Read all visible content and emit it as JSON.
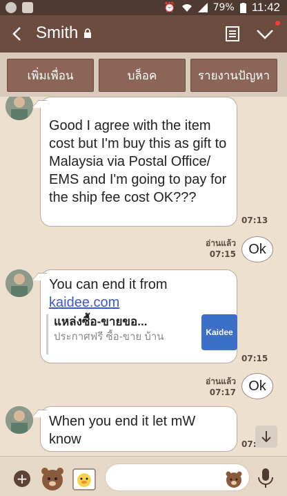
{
  "status_bar": {
    "battery": "79%",
    "time": "11:42",
    "icons": [
      "line-icon",
      "gallery-icon",
      "alarm-icon",
      "wifi-icon",
      "signal-icon",
      "battery-icon"
    ]
  },
  "header": {
    "title": "Smith",
    "icons": [
      "back-icon",
      "lock-icon",
      "note-icon",
      "chevron-down-icon"
    ]
  },
  "actions": {
    "add_friend": "เพิ่มเพื่อน",
    "block": "บล็อค",
    "report": "รายงานปัญหา"
  },
  "messages": {
    "m1": {
      "text": "Good I agree with the item cost but I'm buy this as gift to Malaysia via Postal Office/ EMS and I'm going to pay for the ship fee cost OK???",
      "time": "07:13"
    },
    "m2": {
      "text": "Ok",
      "read": "อ่านแล้ว",
      "time": "07:15"
    },
    "m3": {
      "text": "You can end it from",
      "link": "kaidee.com",
      "time": "07:15",
      "preview_title": "แหล่งซื้อ-ขายขอ...",
      "preview_desc": "ประกาศฟรี ซื้อ-ขาย บ้าน",
      "logo": "Kaidee"
    },
    "m4": {
      "text": "Ok",
      "read": "อ่านแล้ว",
      "time": "07:17"
    },
    "m5": {
      "text": "When you end it let mW know",
      "time": "07:18"
    }
  },
  "colors": {
    "header": "#6b4c3e",
    "status_bar": "#4e3a30",
    "action_button": "#8b6557",
    "chat_bg": "#ede0cf",
    "link": "#3a5acc",
    "kaidee_blue": "#3c6fc8"
  }
}
